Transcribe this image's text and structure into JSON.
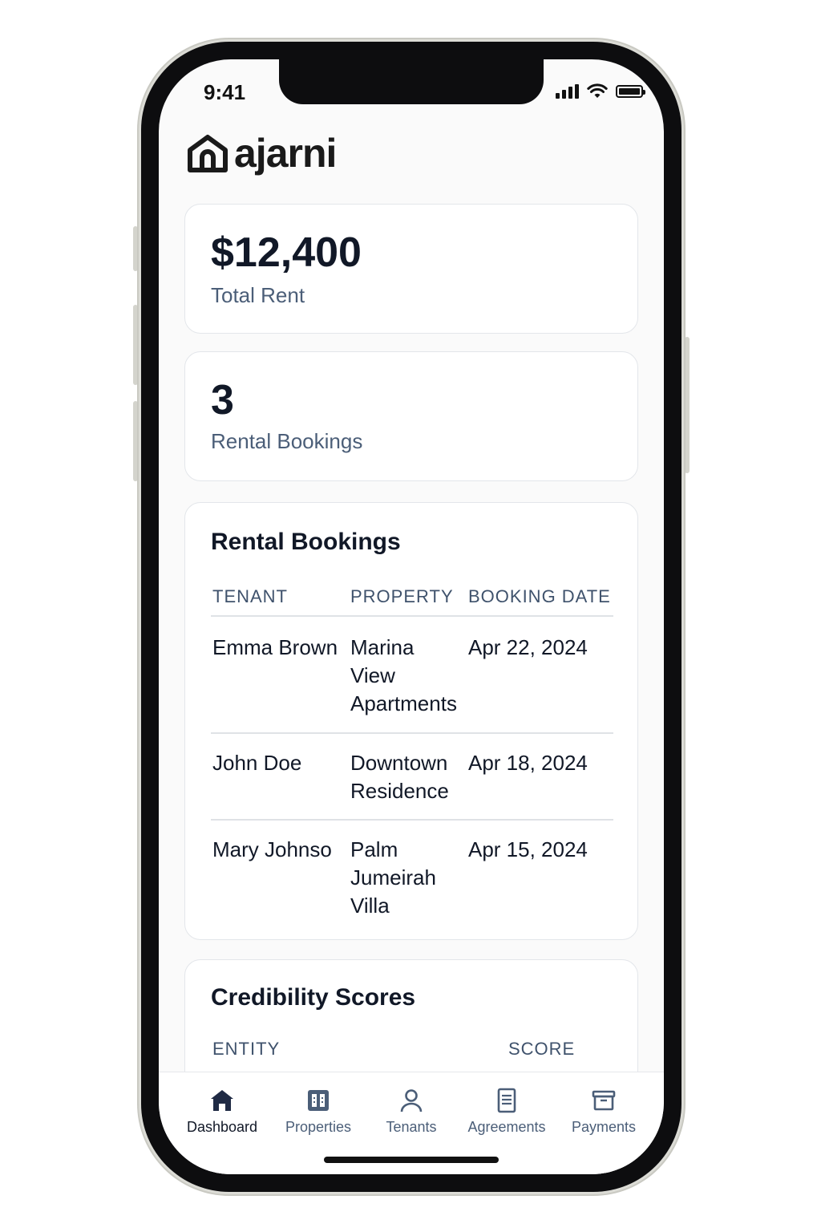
{
  "status_bar": {
    "time": "9:41"
  },
  "app": {
    "logo_text": "ajarni",
    "logo_icon": "house-icon"
  },
  "stats": [
    {
      "value": "$12,400",
      "label": "Total Rent"
    },
    {
      "value": "3",
      "label": "Rental Bookings"
    }
  ],
  "bookings": {
    "title": "Rental Bookings",
    "columns": [
      "TENANT",
      "PROPERTY",
      "BOOKING DATE"
    ],
    "rows": [
      {
        "tenant": "Emma Brown",
        "property": [
          "Marina",
          "View",
          "Apartments"
        ],
        "date": "Apr 22, 2024"
      },
      {
        "tenant": "John Doe",
        "property": [
          "Downtown",
          "Residence"
        ],
        "date": "Apr 18, 2024"
      },
      {
        "tenant": "Mary Johnso",
        "property": [
          "Palm",
          "Jumeirah",
          "Villa"
        ],
        "date": "Apr 15, 2024"
      }
    ]
  },
  "credibility": {
    "title": "Credibility Scores",
    "columns": [
      "ENTITY",
      "SCORE"
    ]
  },
  "tabbar": {
    "active": "Dashboard",
    "tabs": [
      {
        "label": "Dashboard",
        "icon": "house-icon"
      },
      {
        "label": "Properties",
        "icon": "building-icon"
      },
      {
        "label": "Tenants",
        "icon": "person-icon"
      },
      {
        "label": "Agreements",
        "icon": "document-icon"
      },
      {
        "label": "Payments",
        "icon": "archive-icon"
      }
    ]
  },
  "colors": {
    "primary_text": "#111827",
    "muted_text": "#4b5e78",
    "card_border": "#e3e6ea",
    "active_icon": "#1f2a44"
  }
}
